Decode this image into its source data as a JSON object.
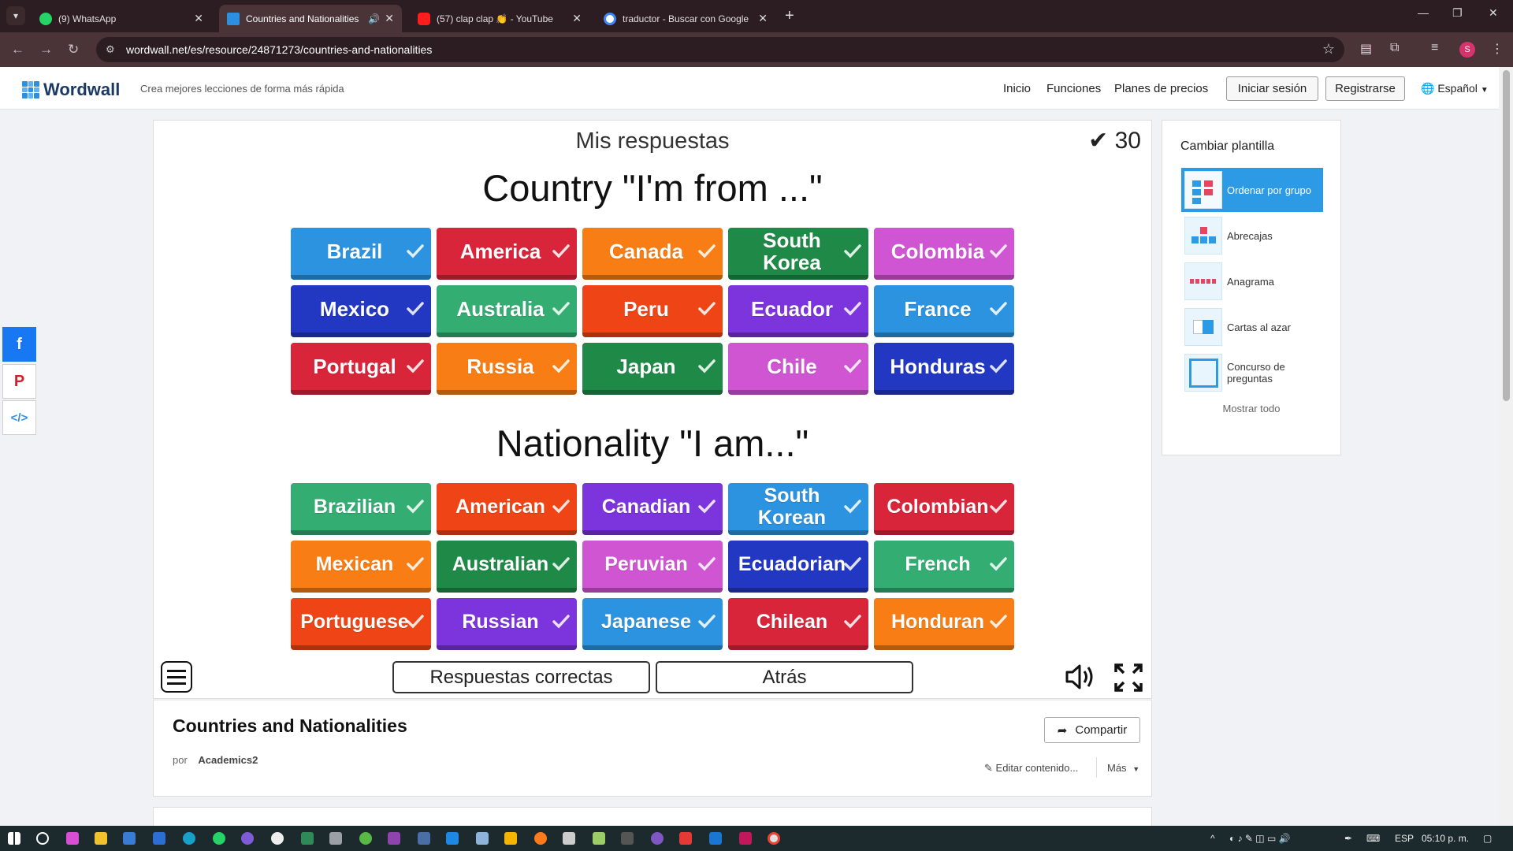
{
  "browser": {
    "tabs": [
      {
        "label": "(9) WhatsApp",
        "active": false
      },
      {
        "label": "Countries and Nationalities",
        "active": true
      },
      {
        "label": "(57) clap clap 👏 - YouTube",
        "active": false
      },
      {
        "label": "traductor - Buscar con Google",
        "active": false
      }
    ],
    "url": "wordwall.net/es/resource/24871273/countries-and-nationalities",
    "profile_initial": "S"
  },
  "site": {
    "logo": "Wordwall",
    "tagline": "Crea mejores lecciones de forma más rápida",
    "nav": [
      "Inicio",
      "Funciones",
      "Planes de precios"
    ],
    "login": "Iniciar sesión",
    "register": "Registrarse",
    "language": "Español"
  },
  "activity": {
    "title": "Mis respuestas",
    "score": "30",
    "groups": [
      {
        "title": "Country \"I'm from ...\"",
        "items": [
          {
            "label": "Brazil",
            "color": "#2c93e0"
          },
          {
            "label": "America",
            "color": "#d8253a"
          },
          {
            "label": "Canada",
            "color": "#f77d14"
          },
          {
            "label": "South Korea",
            "color": "#1f8a48"
          },
          {
            "label": "Colombia",
            "color": "#cf55d2"
          },
          {
            "label": "Mexico",
            "color": "#2238c2"
          },
          {
            "label": "Australia",
            "color": "#33ad72"
          },
          {
            "label": "Peru",
            "color": "#ef4415"
          },
          {
            "label": "Ecuador",
            "color": "#7c34dc"
          },
          {
            "label": "France",
            "color": "#2c93e0"
          },
          {
            "label": "Portugal",
            "color": "#d8253a"
          },
          {
            "label": "Russia",
            "color": "#f77d14"
          },
          {
            "label": "Japan",
            "color": "#1f8a48"
          },
          {
            "label": "Chile",
            "color": "#cf55d2"
          },
          {
            "label": "Honduras",
            "color": "#2238c2"
          }
        ]
      },
      {
        "title": "Nationality \"I am...\"",
        "items": [
          {
            "label": "Brazilian",
            "color": "#33ad72"
          },
          {
            "label": "American",
            "color": "#ef4415"
          },
          {
            "label": "Canadian",
            "color": "#7c34dc"
          },
          {
            "label": "South Korean",
            "color": "#2c93e0"
          },
          {
            "label": "Colombian",
            "color": "#d8253a"
          },
          {
            "label": "Mexican",
            "color": "#f77d14"
          },
          {
            "label": "Australian",
            "color": "#1f8a48"
          },
          {
            "label": "Peruvian",
            "color": "#cf55d2"
          },
          {
            "label": "Ecuadorian",
            "color": "#2238c2"
          },
          {
            "label": "French",
            "color": "#33ad72"
          },
          {
            "label": "Portuguese",
            "color": "#ef4415"
          },
          {
            "label": "Russian",
            "color": "#7c34dc"
          },
          {
            "label": "Japanese",
            "color": "#2c93e0"
          },
          {
            "label": "Chilean",
            "color": "#d8253a"
          },
          {
            "label": "Honduran",
            "color": "#f77d14"
          }
        ]
      }
    ],
    "buttons": {
      "correct": "Respuestas correctas",
      "back": "Atrás"
    }
  },
  "info": {
    "title": "Countries and Nationalities",
    "by_label": "por",
    "author": "Academics2",
    "share": "Compartir",
    "edit": "Editar contenido...",
    "more": "Más"
  },
  "templates": {
    "title": "Cambiar plantilla",
    "items": [
      "Ordenar por grupo",
      "Abrecajas",
      "Anagrama",
      "Cartas al azar",
      "Concurso de preguntas"
    ],
    "show_all": "Mostrar todo"
  },
  "taskbar": {
    "lang": "ESP",
    "time": "05:10 p. m."
  }
}
